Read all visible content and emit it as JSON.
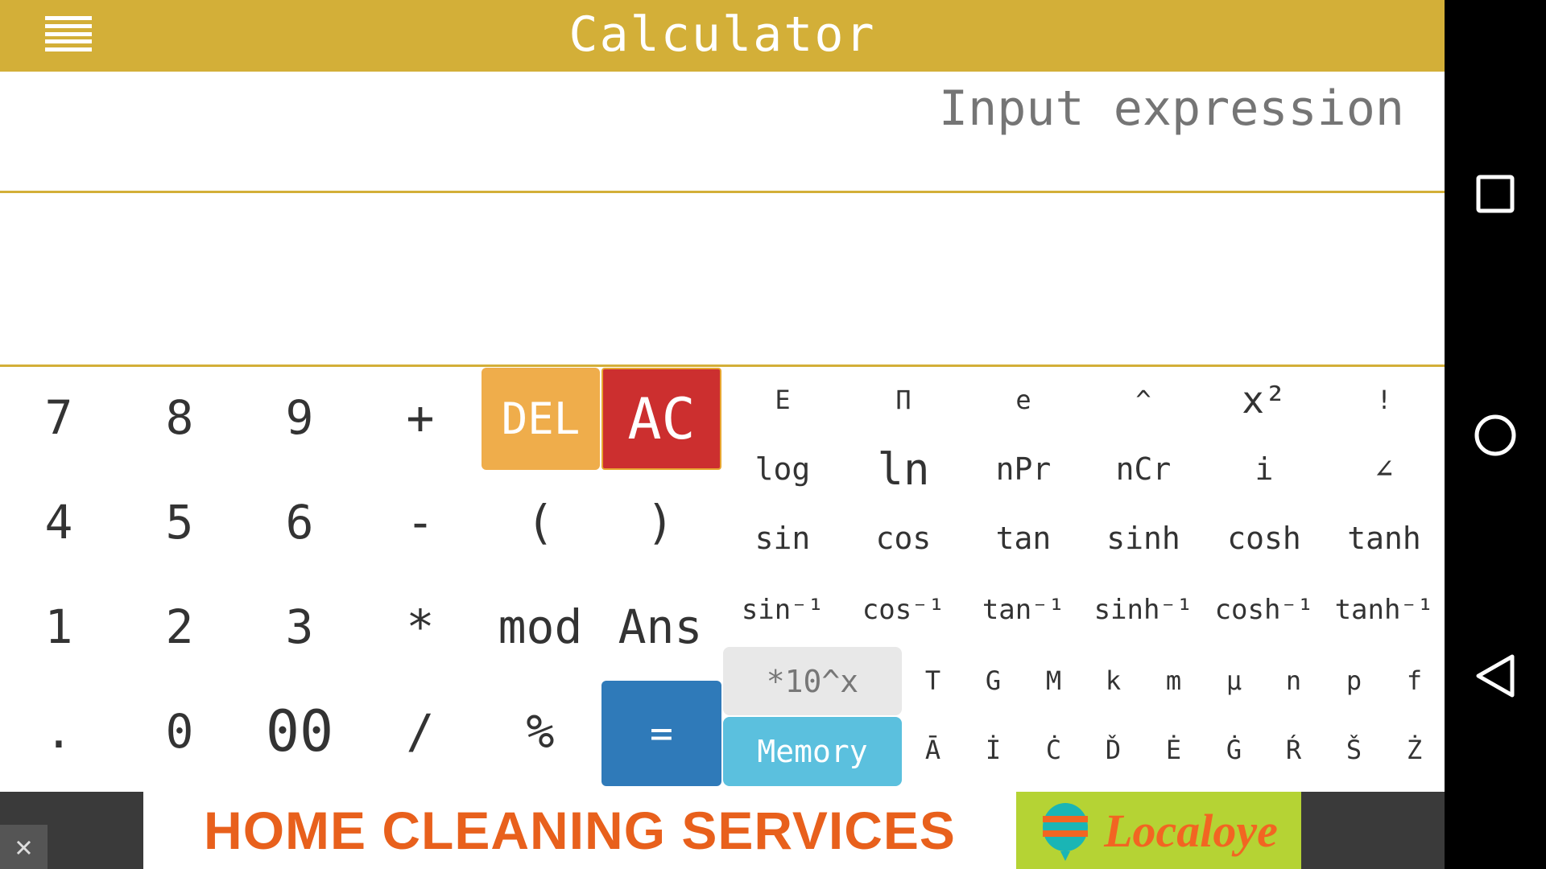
{
  "header": {
    "title": "Calculator",
    "menu_icon": "hamburger-icon"
  },
  "input": {
    "placeholder": "Input expression",
    "value": ""
  },
  "keypad": {
    "rows": [
      [
        "7",
        "8",
        "9",
        "+"
      ],
      [
        "4",
        "5",
        "6",
        "-",
        "(",
        ")"
      ],
      [
        "1",
        "2",
        "3",
        "*",
        "mod",
        "Ans"
      ],
      [
        ".",
        "0",
        "00",
        "/",
        "%"
      ]
    ],
    "del": "DEL",
    "ac": "AC",
    "equals": "=",
    "colors": {
      "del": "#efad4b",
      "ac": "#cc2f2f",
      "equals": "#2f7ab9",
      "memory": "#5bc0de",
      "accent": "#d3af38"
    }
  },
  "functions": {
    "rows": [
      [
        "E",
        "Π",
        "e",
        "^",
        "x²",
        "!"
      ],
      [
        "log",
        "ln",
        "nPr",
        "nCr",
        "i",
        "∠"
      ],
      [
        "sin",
        "cos",
        "tan",
        "sinh",
        "cosh",
        "tanh"
      ],
      [
        "sin⁻¹",
        "cos⁻¹",
        "tan⁻¹",
        "sinh⁻¹",
        "cosh⁻¹",
        "tanh⁻¹"
      ]
    ],
    "exp": "*10^x",
    "memory": "Memory",
    "units": [
      "T",
      "G",
      "M",
      "k",
      "m",
      "μ",
      "n",
      "p",
      "f"
    ],
    "variables": [
      "Ā",
      "İ",
      "Ċ",
      "Ď",
      "Ė",
      "Ġ",
      "Ŕ",
      "Š",
      "Ż"
    ]
  },
  "ad": {
    "text": "HOME CLEANING SERVICES",
    "brand": "Localoye",
    "close": "✕"
  },
  "nav": {
    "recents": "square-icon",
    "home": "circle-icon",
    "back": "triangle-back-icon"
  }
}
